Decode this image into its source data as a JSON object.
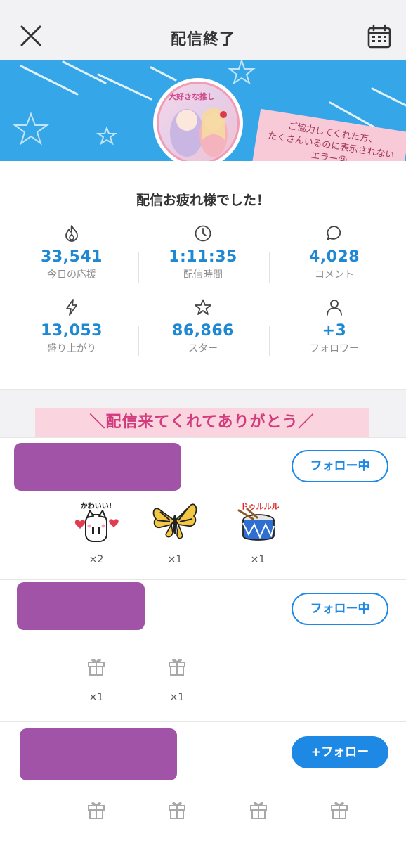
{
  "header": {
    "title": "配信終了",
    "close_icon": "close-icon",
    "calendar_icon": "calendar-icon"
  },
  "banner": {
    "avatar_tag": "大好きな推し",
    "note_lines": [
      "ご協力してくれた方、",
      "たくさんいるのに表示されない",
      "エラー😜"
    ]
  },
  "summary": {
    "heading": "配信お疲れ様でした！",
    "stats": [
      {
        "icon": "flame-icon",
        "value": "33,541",
        "label": "今日の応援"
      },
      {
        "icon": "clock-icon",
        "value": "1:11:35",
        "label": "配信時間"
      },
      {
        "icon": "comment-icon",
        "value": "4,028",
        "label": "コメント"
      },
      {
        "icon": "lightning-icon",
        "value": "13,053",
        "label": "盛り上がり"
      },
      {
        "icon": "star-icon",
        "value": "86,866",
        "label": "スター"
      },
      {
        "icon": "person-icon",
        "value": "+3",
        "label": "フォロワー"
      }
    ]
  },
  "thanks": {
    "text": "＼配信来てくれてありがとう／"
  },
  "viewers": [
    {
      "follow_label": "フォロー中",
      "gifts": [
        {
          "icon": "kawaii-cat-gift-icon",
          "count": "×2",
          "caption": "かわいい!"
        },
        {
          "icon": "butterfly-gift-icon",
          "count": "×1"
        },
        {
          "icon": "drum-gift-icon",
          "count": "×1",
          "caption": "ドゥルルル"
        }
      ]
    },
    {
      "follow_label": "フォロー中",
      "gifts": [
        {
          "icon": "gift-box-icon",
          "count": "×1"
        },
        {
          "icon": "gift-box-icon",
          "count": "×1"
        }
      ]
    },
    {
      "follow_label": "+フォロー",
      "gifts": [
        {
          "icon": "gift-box-icon"
        },
        {
          "icon": "gift-box-icon"
        },
        {
          "icon": "gift-box-icon"
        },
        {
          "icon": "gift-box-icon"
        }
      ]
    }
  ],
  "colors": {
    "accent": "#1e88e5",
    "banner": "#35a6e8",
    "redaction": "#a153a8",
    "thanks_bg": "#fad5df",
    "thanks_text": "#d23c7c"
  }
}
